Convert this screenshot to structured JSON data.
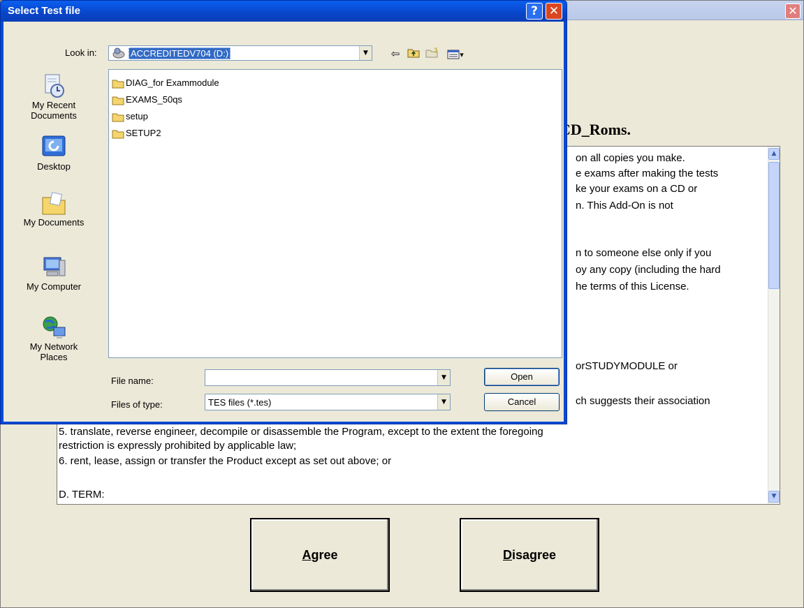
{
  "background_window": {
    "close_glyph": "✕",
    "heading": "CD_Roms.",
    "license_lines": [
      "on all copies you make.",
      "e exams after making the tests",
      "ke your exams on a CD or",
      "n.  This Add-On is not",
      "n to someone else only if you",
      "oy any copy (including the hard",
      "he terms of this License.",
      "orSTUDYMODULE or",
      "ch suggests their association",
      "5.         translate, reverse engineer, decompile or disassemble the Program, except to the extent the foregoing",
      "restriction is expressly prohibited by applicable law;",
      "6.         rent, lease, assign or transfer the Product except as set out above; or",
      "D.         TERM:"
    ],
    "agree_button": {
      "accel": "A",
      "rest": "gree"
    },
    "disagree_button": {
      "accel": "D",
      "rest": "isagree"
    }
  },
  "dialog": {
    "title": "Select Test file",
    "help_glyph": "?",
    "close_glyph": "✕",
    "look_in_label": "Look in:",
    "look_in_value": "ACCREDITEDV704 (D:)",
    "toolbar": {
      "back_glyph": "⇦",
      "views_glyph": "▾"
    },
    "places": [
      {
        "label": "My Recent Documents",
        "icon": "recent-documents-icon"
      },
      {
        "label": "Desktop",
        "icon": "desktop-icon"
      },
      {
        "label": "My Documents",
        "icon": "my-documents-icon"
      },
      {
        "label": "My Computer",
        "icon": "my-computer-icon"
      },
      {
        "label": "My Network Places",
        "icon": "network-places-icon"
      }
    ],
    "files": [
      "DIAG_for Exammodule",
      "EXAMS_50qs",
      "setup",
      "SETUP2"
    ],
    "file_name_label": "File name:",
    "file_name_value": "",
    "files_of_type_label": "Files of type:",
    "files_of_type_value": "TES files (*.tes)",
    "open_button": "Open",
    "cancel_button": "Cancel"
  }
}
